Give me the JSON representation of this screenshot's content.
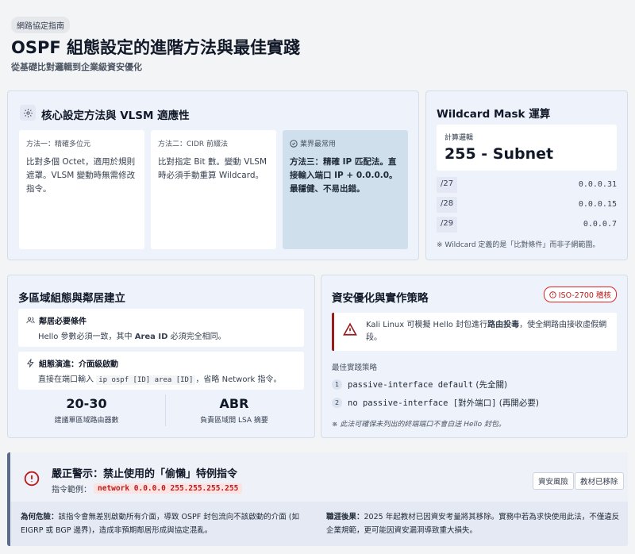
{
  "header": {
    "tag": "網路協定指南",
    "title": "OSPF 組態設定的進階方法與最佳實踐",
    "subtitle": "從基礎比對邏輯到企業級資安優化"
  },
  "core": {
    "title": "核心設定方法與 VLSM 適應性",
    "methods": [
      {
        "label": "方法一：精確多位元",
        "text": "比對多個 Octet，適用於規則遮罩。VLSM 變動時無需修改指令。"
      },
      {
        "label": "方法二：CIDR 前綴法",
        "text": "比對指定 Bit 數。變動 VLSM 時必須手動重算 Wildcard。"
      },
      {
        "label": "業界最常用",
        "text": "方法三：精確 IP 匹配法。直接輸入端口 IP + 0.0.0.0。最穩健、不易出錯。"
      }
    ]
  },
  "wildcard": {
    "title": "Wildcard Mask 運算",
    "calc_label": "計算邏輯",
    "calc_value": "255 - Subnet",
    "rows": [
      {
        "prefix": "/27",
        "mask": "0.0.0.31"
      },
      {
        "prefix": "/28",
        "mask": "0.0.0.15"
      },
      {
        "prefix": "/29",
        "mask": "0.0.0.7"
      }
    ],
    "note": "※ Wildcard 定義的是「比對條件」而非子網範圍。"
  },
  "area": {
    "title": "多區域組態與鄰居建立",
    "cond1_title": "鄰居必要條件",
    "cond1_pre": "Hello 參數必須一致，其中 ",
    "cond1_bold": "Area ID",
    "cond1_post": " 必須完全相同。",
    "cond2_title": "組態演進：介面級啟動",
    "cond2_pre": "直接在端口輸入 ",
    "cond2_code": "ip ospf [ID] area [ID]",
    "cond2_post": "，省略 Network 指令。",
    "stats": [
      {
        "value": "20-30",
        "desc": "建議單區域路由器數"
      },
      {
        "value": "ABR",
        "desc": "負責區域間 LSA 摘要"
      }
    ]
  },
  "security": {
    "title": "資安優化與實作策略",
    "badge": "ISO-2700 稽核",
    "alert_pre": "Kali Linux 可模擬 Hello 封包進行",
    "alert_bold": "路由投毒",
    "alert_post": "，使全網路由接收虛假網段。",
    "bp_title": "最佳實踐策略",
    "practices": [
      {
        "num": "1",
        "code": "passive-interface default",
        "note": " (先全關)"
      },
      {
        "num": "2",
        "code": "no passive-interface [對外端口]",
        "note": " (再開必要)"
      }
    ],
    "note": "※ 此法可確保未列出的終端端口不會白送 Hello 封包。"
  },
  "warning": {
    "title": "嚴正警示：禁止使用的「偷懶」特例指令",
    "example_label": "指令範例：",
    "example_code": "network 0.0.0.0 255.255.255.255",
    "pills": [
      "資安風險",
      "教材已移除"
    ],
    "danger_label": "為何危險：",
    "danger_text": "該指令會無差別啟動所有介面，導致 OSPF 封包流向不該啟動的介面 (如 EIGRP 或 BGP 邊界)，造成非預期鄰居形成與協定混亂。",
    "career_label": "職涯後果：",
    "career_text": "2025 年起教材已因資安考量將其移除。實務中若為求快使用此法，不僅違反企業規範，更可能因資安漏洞導致重大損失。"
  },
  "colors": {
    "accent_red": "#b91c1c",
    "card_bg": "#eef2fb",
    "highlight": "#cfe0ec"
  }
}
